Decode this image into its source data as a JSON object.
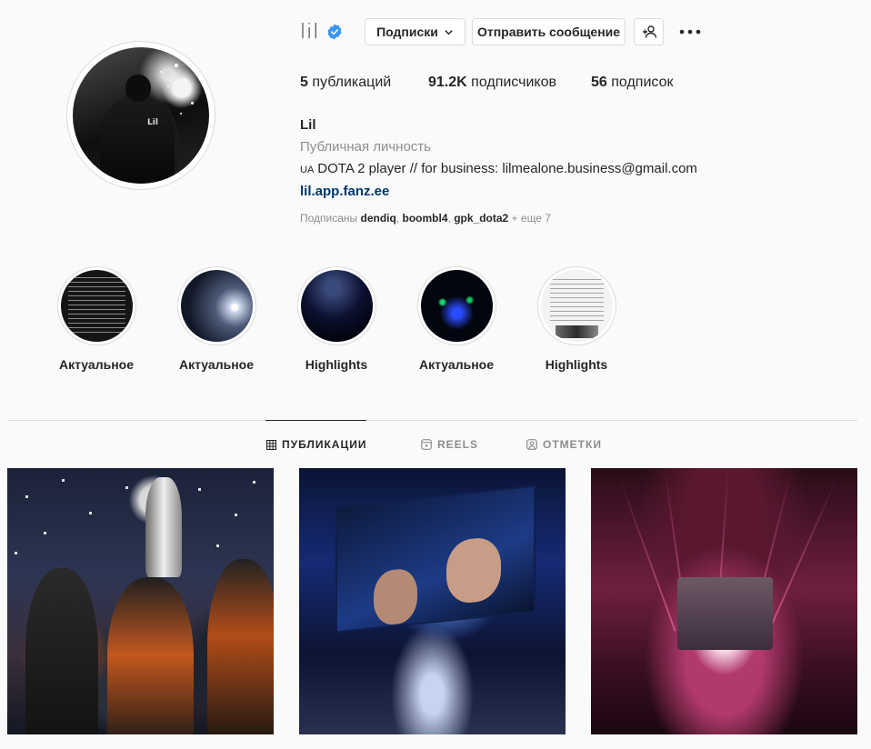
{
  "profile": {
    "username": "lil",
    "verified": true,
    "follow_button_label": "Подписки",
    "message_button_label": "Отправить сообщение",
    "stats": [
      {
        "value": "5",
        "label": "публикаций"
      },
      {
        "value": "91.2K",
        "label": "подписчиков"
      },
      {
        "value": "56",
        "label": "подписок"
      }
    ],
    "name": "Lil",
    "category": "Публичная личность",
    "bio_flag": "UA",
    "bio_text": "DOTA 2 player // for business: lilmealone.business@gmail.com",
    "link": "lil.app.fanz.ee",
    "followed_by_prefix": "Подписаны",
    "followed_by_users": [
      "dendiq",
      "boombl4",
      "gpk_dota2"
    ],
    "followed_by_more": "+ еще 7"
  },
  "highlights": [
    {
      "label": "Актуальное"
    },
    {
      "label": "Актуальное"
    },
    {
      "label": "Highlights"
    },
    {
      "label": "Актуальное"
    },
    {
      "label": "Highlights"
    }
  ],
  "tabs": [
    {
      "label": "ПУБЛИКАЦИИ",
      "icon": "grid-icon",
      "active": true
    },
    {
      "label": "REELS",
      "icon": "reels-icon",
      "active": false
    },
    {
      "label": "ОТМЕТКИ",
      "icon": "tagged-icon",
      "active": false
    }
  ],
  "posts": [
    {
      "image": "team-trophy-celebration"
    },
    {
      "image": "player-on-big-screen"
    },
    {
      "image": "esports-arena"
    }
  ],
  "colors": {
    "verified_blue": "#3897f0",
    "link_blue": "#00376b",
    "secondary_text": "#8e8e8e",
    "border": "#dbdbdb"
  }
}
